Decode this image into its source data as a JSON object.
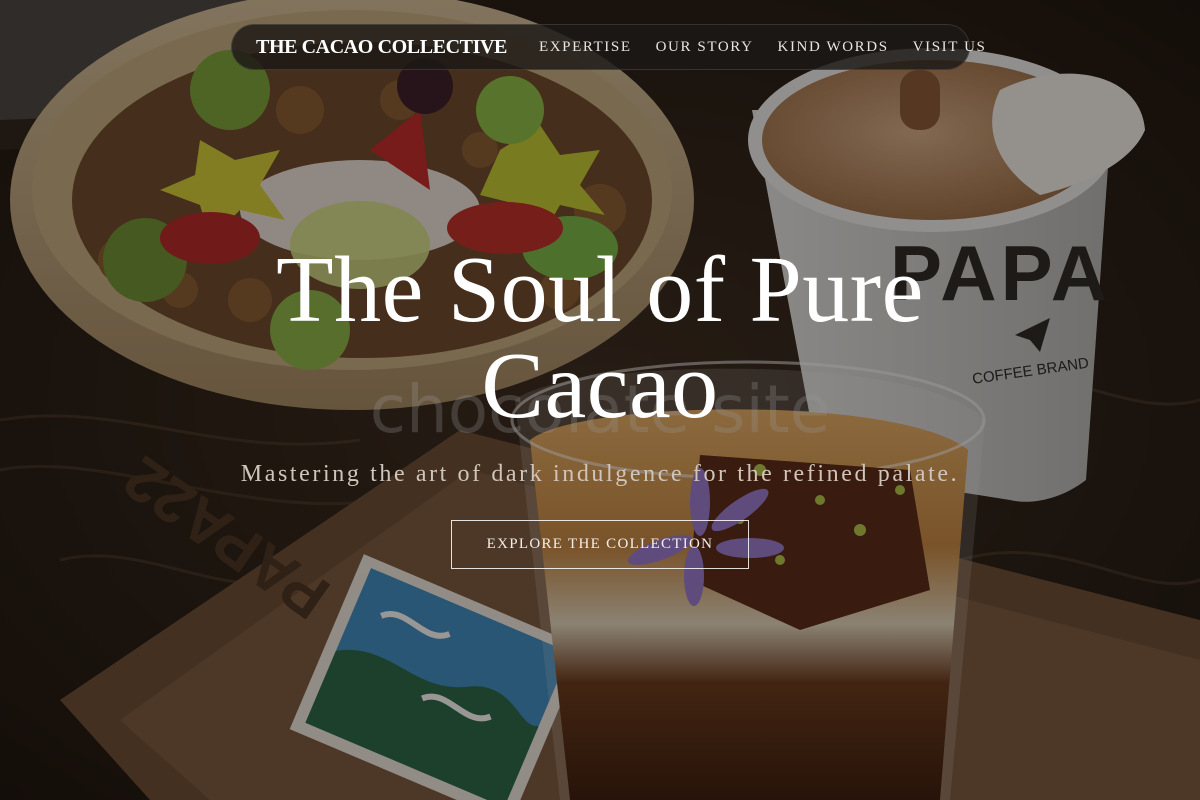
{
  "nav": {
    "brand": "THE CACAO COLLECTIVE",
    "links": [
      {
        "label": "EXPERTISE"
      },
      {
        "label": "OUR STORY"
      },
      {
        "label": "KIND WORDS"
      },
      {
        "label": "VISIT US"
      }
    ]
  },
  "hero": {
    "title_line1": "The Soul of Pure",
    "title_line2": "Cacao",
    "subtitle": "Mastering the art of dark indulgence for the refined palate.",
    "cta_label": "EXPLORE THE COLLECTION",
    "background_texts": {
      "cup_brand": "PAPA",
      "cup_tagline": "COFFEE BRAND",
      "tray_brand": "PAPA22",
      "watermark": "chocolate site"
    }
  },
  "colors": {
    "nav_bg": "#1c1816",
    "title": "#ffffff",
    "subtitle": "#cfc5bb",
    "cta_border": "#ffffff"
  }
}
